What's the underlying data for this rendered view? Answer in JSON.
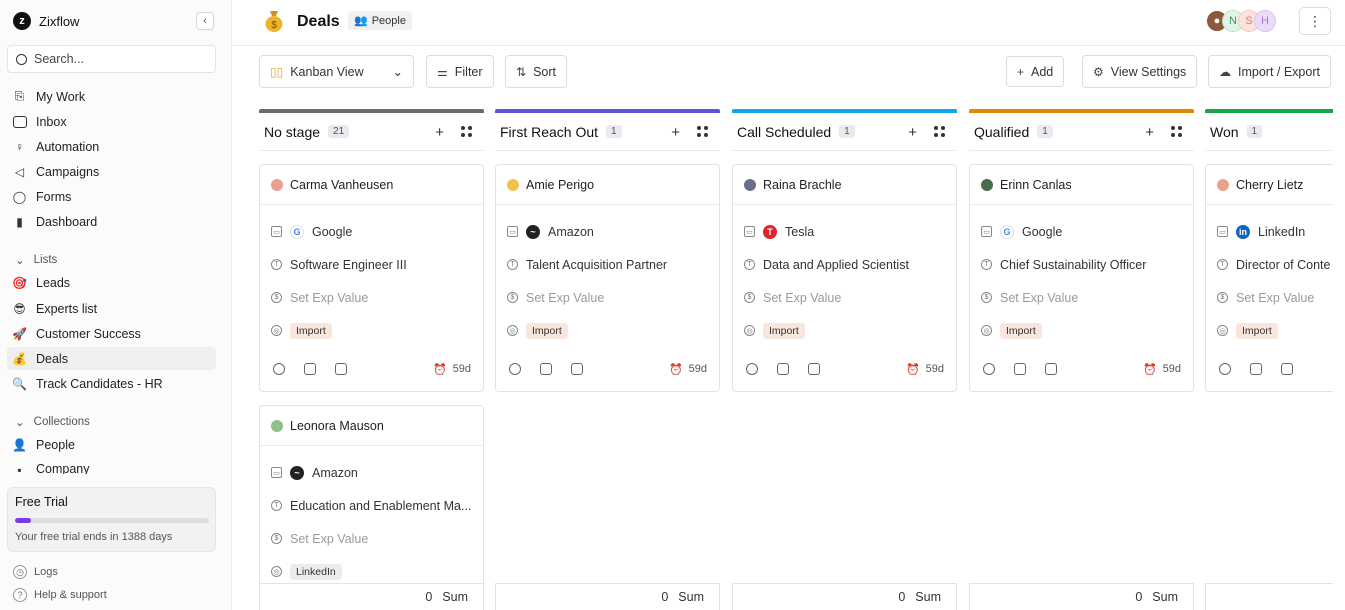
{
  "app": {
    "name": "Zixflow"
  },
  "sidebar": {
    "search_placeholder": "Search...",
    "nav": [
      {
        "label": "My Work"
      },
      {
        "label": "Inbox"
      },
      {
        "label": "Automation"
      },
      {
        "label": "Campaigns"
      },
      {
        "label": "Forms"
      },
      {
        "label": "Dashboard"
      }
    ],
    "lists_title": "Lists",
    "lists": [
      {
        "label": "Leads",
        "icon": "target-icon"
      },
      {
        "label": "Experts list",
        "icon": "smiley-icon"
      },
      {
        "label": "Customer Success",
        "icon": "rocket-icon"
      },
      {
        "label": "Deals",
        "icon": "money-bag-icon"
      },
      {
        "label": "Track Candidates - HR",
        "icon": "magnifier-icon"
      }
    ],
    "collections_title": "Collections",
    "collections": [
      {
        "label": "People"
      },
      {
        "label": "Company"
      }
    ],
    "free_trial": {
      "title": "Free Trial",
      "text": "Your free trial ends in 1388 days",
      "progress": 0.08
    },
    "footer": [
      {
        "label": "Logs"
      },
      {
        "label": "Help & support"
      }
    ]
  },
  "header": {
    "title": "Deals",
    "badge": "People",
    "avatars": [
      "N",
      "S",
      "H"
    ]
  },
  "toolbar": {
    "view": "Kanban View",
    "filter": "Filter",
    "sort": "Sort",
    "add": "Add",
    "view_settings": "View Settings",
    "import_export": "Import / Export"
  },
  "columns": [
    {
      "title": "No stage",
      "count": "21",
      "color": "#6b6b6b",
      "sum_value": "0",
      "sum_label": "Sum",
      "cards": [
        {
          "name": "Carma Vanheusen",
          "company": "Google",
          "title": "Software Engineer III",
          "exp": "Set Exp Value",
          "tag": "Import",
          "age": "59d"
        },
        {
          "name": "Leonora Mauson",
          "company": "Amazon",
          "title": "Education and Enablement Ma...",
          "exp": "Set Exp Value",
          "tag": "LinkedIn"
        }
      ]
    },
    {
      "title": "First Reach Out",
      "count": "1",
      "color": "#5b57d1",
      "sum_value": "0",
      "sum_label": "Sum",
      "cards": [
        {
          "name": "Amie Perigo",
          "company": "Amazon",
          "title": "Talent Acquisition Partner",
          "exp": "Set Exp Value",
          "tag": "Import",
          "age": "59d"
        }
      ]
    },
    {
      "title": "Call Scheduled",
      "count": "1",
      "color": "#0ea5e9",
      "sum_value": "0",
      "sum_label": "Sum",
      "cards": [
        {
          "name": "Raina Brachle",
          "company": "Tesla",
          "title": "Data and Applied Scientist",
          "exp": "Set Exp Value",
          "tag": "Import",
          "age": "59d"
        }
      ]
    },
    {
      "title": "Qualified",
      "count": "1",
      "color": "#e5850b",
      "sum_value": "0",
      "sum_label": "Sum",
      "cards": [
        {
          "name": "Erinn Canlas",
          "company": "Google",
          "title": "Chief Sustainability Officer",
          "exp": "Set Exp Value",
          "tag": "Import",
          "age": "59d"
        }
      ]
    },
    {
      "title": "Won",
      "count": "1",
      "color": "#16a34a",
      "sum_value": "",
      "sum_label": "",
      "cards": [
        {
          "name": "Cherry Lietz",
          "company": "LinkedIn",
          "title": "Director of Conte",
          "exp": "Set Exp Value",
          "tag": "Import",
          "age": ""
        }
      ]
    }
  ]
}
